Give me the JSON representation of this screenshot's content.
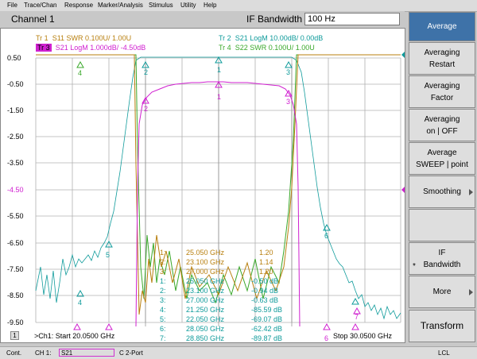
{
  "menu": [
    "File",
    "Trace/Chan",
    "Response",
    "Marker/Analysis",
    "Stimulus",
    "Utility",
    "Help"
  ],
  "title": {
    "channel": "Channel 1",
    "ifbw_label": "IF Bandwidth",
    "ifbw_value": "100 Hz"
  },
  "traces": [
    {
      "id": "Tr 1",
      "text": "S11 SWR 0.100U/  1.00U",
      "color": "#b87f0e"
    },
    {
      "id": "Tr 2",
      "text": "S21 LogM 10.00dB/  0.00dB",
      "color": "#0f9b9b"
    },
    {
      "id": "Tr 3",
      "text": "S21 LogM 1.000dB/ -4.50dB",
      "color": "#d020d0"
    },
    {
      "id": "Tr 4",
      "text": "S22 SWR 0.100U/  1.00U",
      "color": "#3aa82a"
    }
  ],
  "y_ticks": [
    "0.50",
    "-0.50",
    "-1.50",
    "-2.50",
    "-3.50",
    "-4.50",
    "-5.50",
    "-6.50",
    "-7.50",
    "-8.50",
    "-9.50"
  ],
  "marker_table_1": [
    {
      "n": "1:",
      "freq": "25.050 GHz",
      "val": "1.20"
    },
    {
      "n": "2:",
      "freq": "23.100 GHz",
      "val": "1.14"
    },
    {
      "n": "3:",
      "freq": "27.000 GHz",
      "val": "1.20"
    }
  ],
  "marker_table_2": [
    {
      "n": "1:",
      "freq": "25.050 GHz",
      "val": "-0.50 dB"
    },
    {
      "n": "2:",
      "freq": "23.100 GHz",
      "val": "-0.94 dB"
    },
    {
      "n": "3:",
      "freq": "27.000 GHz",
      "val": "-0.63 dB"
    },
    {
      "n": "4:",
      "freq": "21.250 GHz",
      "val": "-85.59 dB"
    },
    {
      "n": "5:",
      "freq": "22.050 GHz",
      "val": "-69.07 dB"
    },
    {
      "n": "6:",
      "freq": "28.050 GHz",
      "val": "-62.42 dB"
    },
    {
      "n": "7:",
      "freq": "28.850 GHz",
      "val": "-89.87 dB"
    }
  ],
  "start_stop": {
    "channel_num": "1",
    "start": ">Ch1: Start  20.0500 GHz",
    "stop": "Stop  30.0500 GHz"
  },
  "softkeys": [
    {
      "label": "Average",
      "active": true,
      "arrow": false
    },
    {
      "label": "Averaging\nRestart",
      "active": false,
      "arrow": false
    },
    {
      "label": "Averaging\nFactor",
      "active": false,
      "arrow": false
    },
    {
      "label": "Averaging\non | OFF",
      "active": false,
      "arrow": false
    },
    {
      "label": "Average\nSWEEP | point",
      "active": false,
      "arrow": false
    },
    {
      "label": "Smoothing",
      "active": false,
      "arrow": true
    },
    {
      "label": "",
      "active": false,
      "arrow": false
    },
    {
      "label": "IF\nBandwidth",
      "active": false,
      "arrow": false,
      "mark": "*"
    },
    {
      "label": "More",
      "active": false,
      "arrow": true
    },
    {
      "label": "Transform",
      "active": false,
      "arrow": false
    }
  ],
  "status": {
    "cont": "Cont.",
    "ch": "CH 1:",
    "trace": "S21",
    "port": "C  2-Port",
    "lcl": "LCL"
  }
}
